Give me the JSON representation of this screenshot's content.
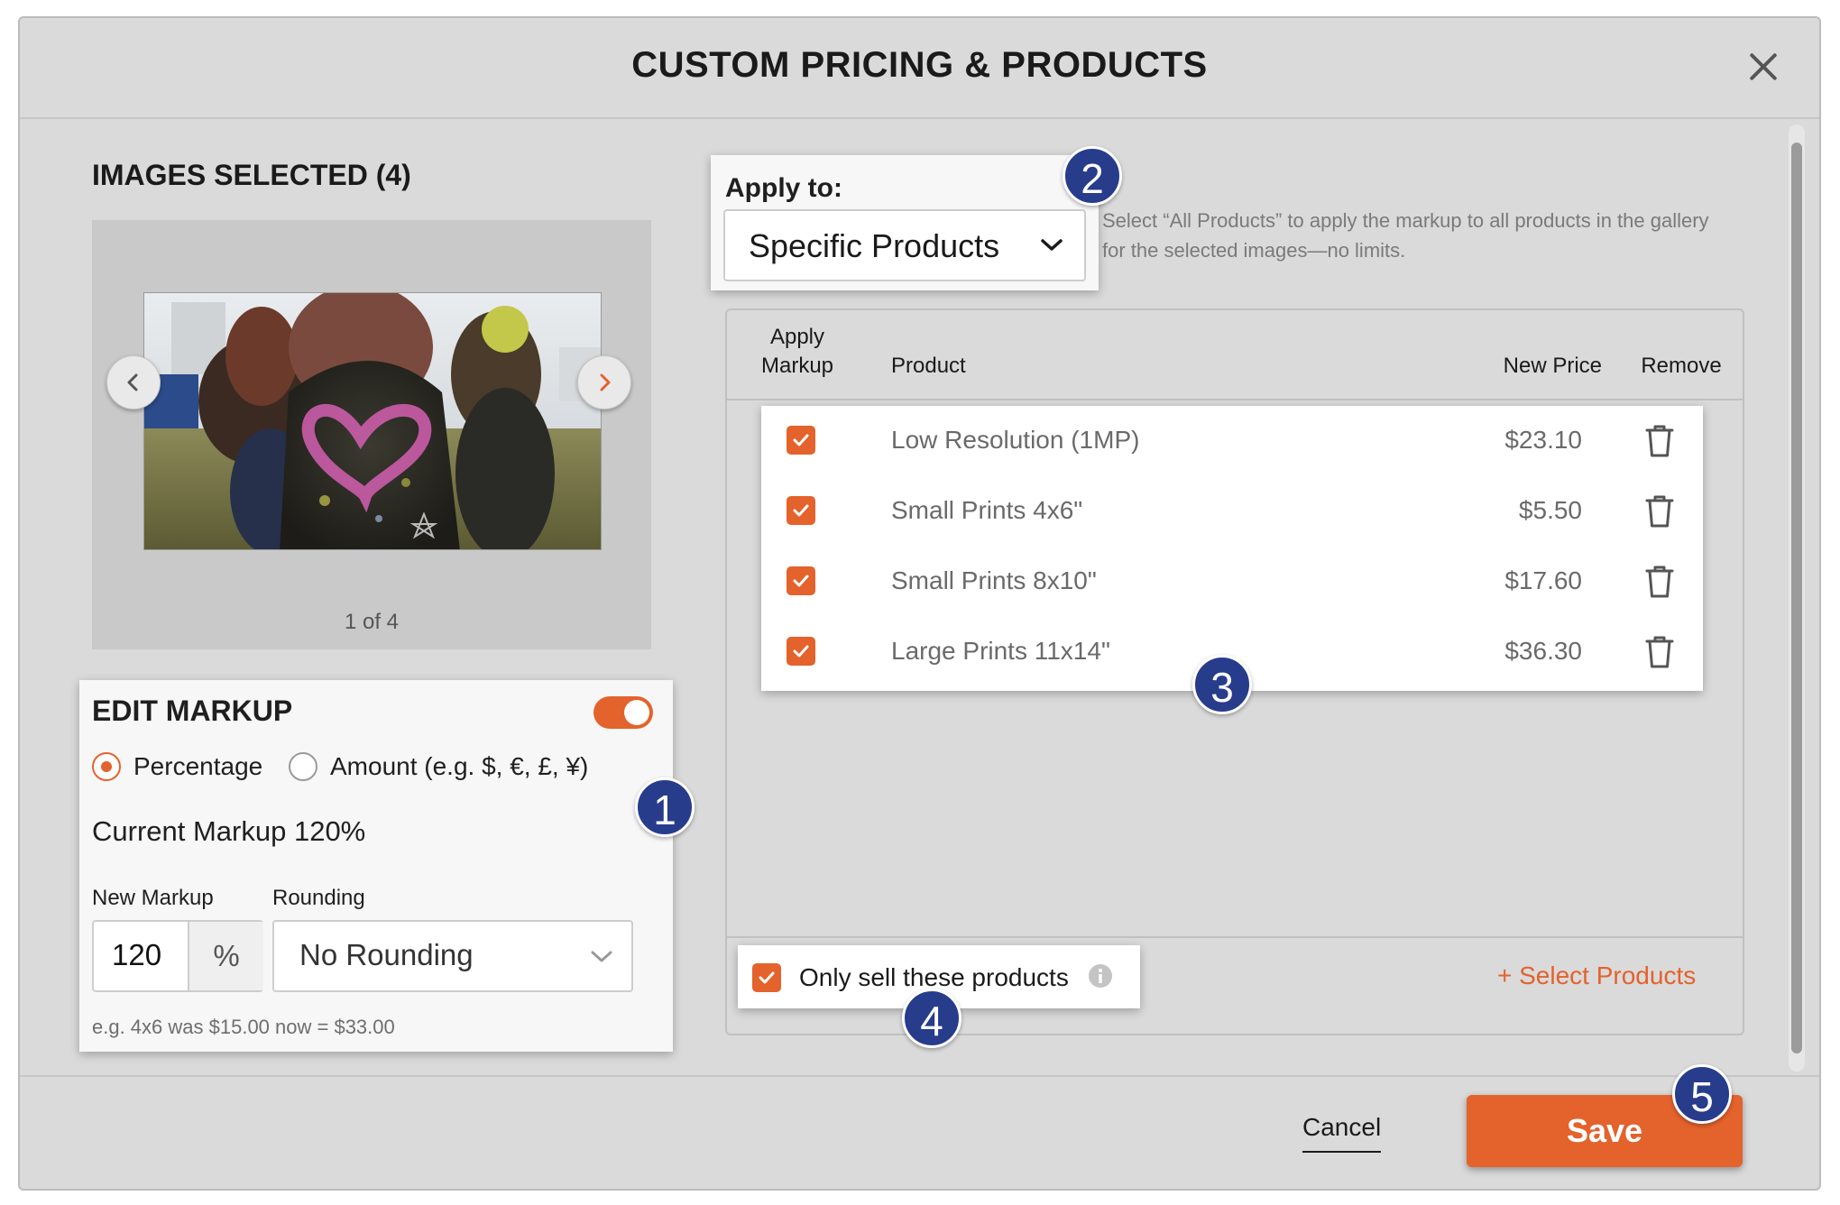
{
  "dialog": {
    "title": "CUSTOM PRICING & PRODUCTS"
  },
  "images": {
    "heading": "IMAGES SELECTED (4)",
    "counter": "1 of 4"
  },
  "edit_markup": {
    "heading": "EDIT MARKUP",
    "toggle_on": true,
    "radio_percentage": "Percentage",
    "radio_amount": "Amount (e.g. $, €, £, ¥)",
    "selected_type": "Percentage",
    "current_markup": "Current Markup 120%",
    "new_markup_label": "New Markup",
    "new_markup_value": "120",
    "unit": "%",
    "rounding_label": "Rounding",
    "rounding_value": "No Rounding",
    "example": "e.g. 4x6 was $15.00 now = $33.00"
  },
  "apply_to": {
    "label": "Apply to:",
    "value": "Specific Products",
    "hint": "Select “All Products” to apply the markup to all products in the gallery for the selected images—no limits."
  },
  "table": {
    "columns": {
      "apply_markup_line1": "Apply",
      "apply_markup_line2": "Markup",
      "product": "Product",
      "new_price": "New Price",
      "remove": "Remove"
    },
    "rows": [
      {
        "checked": true,
        "product": "Low Resolution (1MP)",
        "price": "$23.10"
      },
      {
        "checked": true,
        "product": "Small Prints 4x6\"",
        "price": "$5.50"
      },
      {
        "checked": true,
        "product": "Small Prints 8x10\"",
        "price": "$17.60"
      },
      {
        "checked": true,
        "product": "Large Prints 11x14\"",
        "price": "$36.30"
      }
    ],
    "only_sell_label": "Only sell these products",
    "only_sell_checked": true,
    "select_products": "+ Select Products"
  },
  "footer": {
    "cancel": "Cancel",
    "save": "Save"
  },
  "badges": [
    "1",
    "2",
    "3",
    "4",
    "5"
  ],
  "colors": {
    "accent": "#e4622c",
    "badge": "#283c8c",
    "modal_bg": "#dadada"
  }
}
